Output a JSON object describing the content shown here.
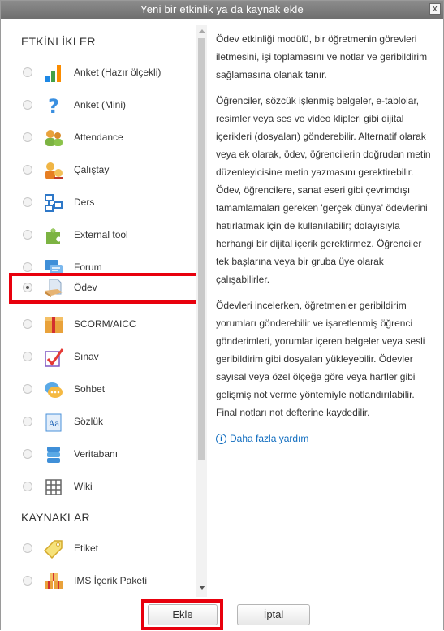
{
  "dialog": {
    "title": "Yeni bir etkinlik ya da kaynak ekle",
    "close_glyph": "x"
  },
  "activities": {
    "heading": "ETKİNLİKLER",
    "items": [
      {
        "label": "Anket (Hazır ölçekli)",
        "icon": "bar-chart-icon",
        "selected": false
      },
      {
        "label": "Anket (Mini)",
        "icon": "question-mark-icon",
        "selected": false
      },
      {
        "label": "Attendance",
        "icon": "people-icon",
        "selected": false
      },
      {
        "label": "Çalıştay",
        "icon": "workshop-icon",
        "selected": false
      },
      {
        "label": "Ders",
        "icon": "lesson-icon",
        "selected": false
      },
      {
        "label": "External tool",
        "icon": "puzzle-icon",
        "selected": false
      },
      {
        "label": "Forum",
        "icon": "forum-icon",
        "selected": false
      },
      {
        "label": "Ödev",
        "icon": "assignment-icon",
        "selected": true
      },
      {
        "label": "SCORM/AICC",
        "icon": "scorm-package-icon",
        "selected": false
      },
      {
        "label": "Sınav",
        "icon": "quiz-checkmark-icon",
        "selected": false
      },
      {
        "label": "Sohbet",
        "icon": "chat-bubble-icon",
        "selected": false
      },
      {
        "label": "Sözlük",
        "icon": "glossary-icon",
        "selected": false
      },
      {
        "label": "Veritabanı",
        "icon": "database-icon",
        "selected": false
      },
      {
        "label": "Wiki",
        "icon": "wiki-icon",
        "selected": false
      }
    ]
  },
  "resources": {
    "heading": "KAYNAKLAR",
    "items": [
      {
        "label": "Etiket",
        "icon": "label-tag-icon",
        "selected": false
      },
      {
        "label": "IMS İçerik Paketi",
        "icon": "ims-package-icon",
        "selected": false
      }
    ]
  },
  "description": {
    "paragraphs": [
      "Ödev etkinliği modülü, bir öğretmenin görevleri iletmesini, işi toplamasını ve notlar ve geribildirim sağlamasına olanak tanır.",
      "Öğrenciler, sözcük işlenmiş belgeler, e-tablolar, resimler veya ses ve video klipleri gibi dijital içerikleri (dosyaları) gönderebilir. Alternatif olarak veya ek olarak, ödev, öğrencilerin doğrudan metin düzenleyicisine metin yazmasını gerektirebilir. Ödev, öğrencilere, sanat eseri gibi çevrimdışı tamamlamaları gereken 'gerçek dünya' ödevlerini hatırlatmak için de kullanılabilir; dolayısıyla herhangi bir dijital içerik gerektirmez. Öğrenciler tek başlarına veya bir gruba üye olarak çalışabilirler.",
      "Ödevleri incelerken, öğretmenler geribildirim yorumları gönderebilir ve işaretlenmiş öğrenci gönderimleri, yorumlar içeren belgeler veya sesli geribildirim gibi dosyaları yükleyebilir. Ödevler sayısal veya özel ölçeğe göre veya harfler gibi gelişmiş not verme yöntemiyle notlandırılabilir. Final notları not defterine kaydedilir."
    ],
    "more_help": "Daha fazla yardım"
  },
  "footer": {
    "add_label": "Ekle",
    "cancel_label": "İptal"
  },
  "colors": {
    "highlight": "#e8000d",
    "link": "#0f6cbf",
    "titlebar": "#7d7d7d"
  }
}
